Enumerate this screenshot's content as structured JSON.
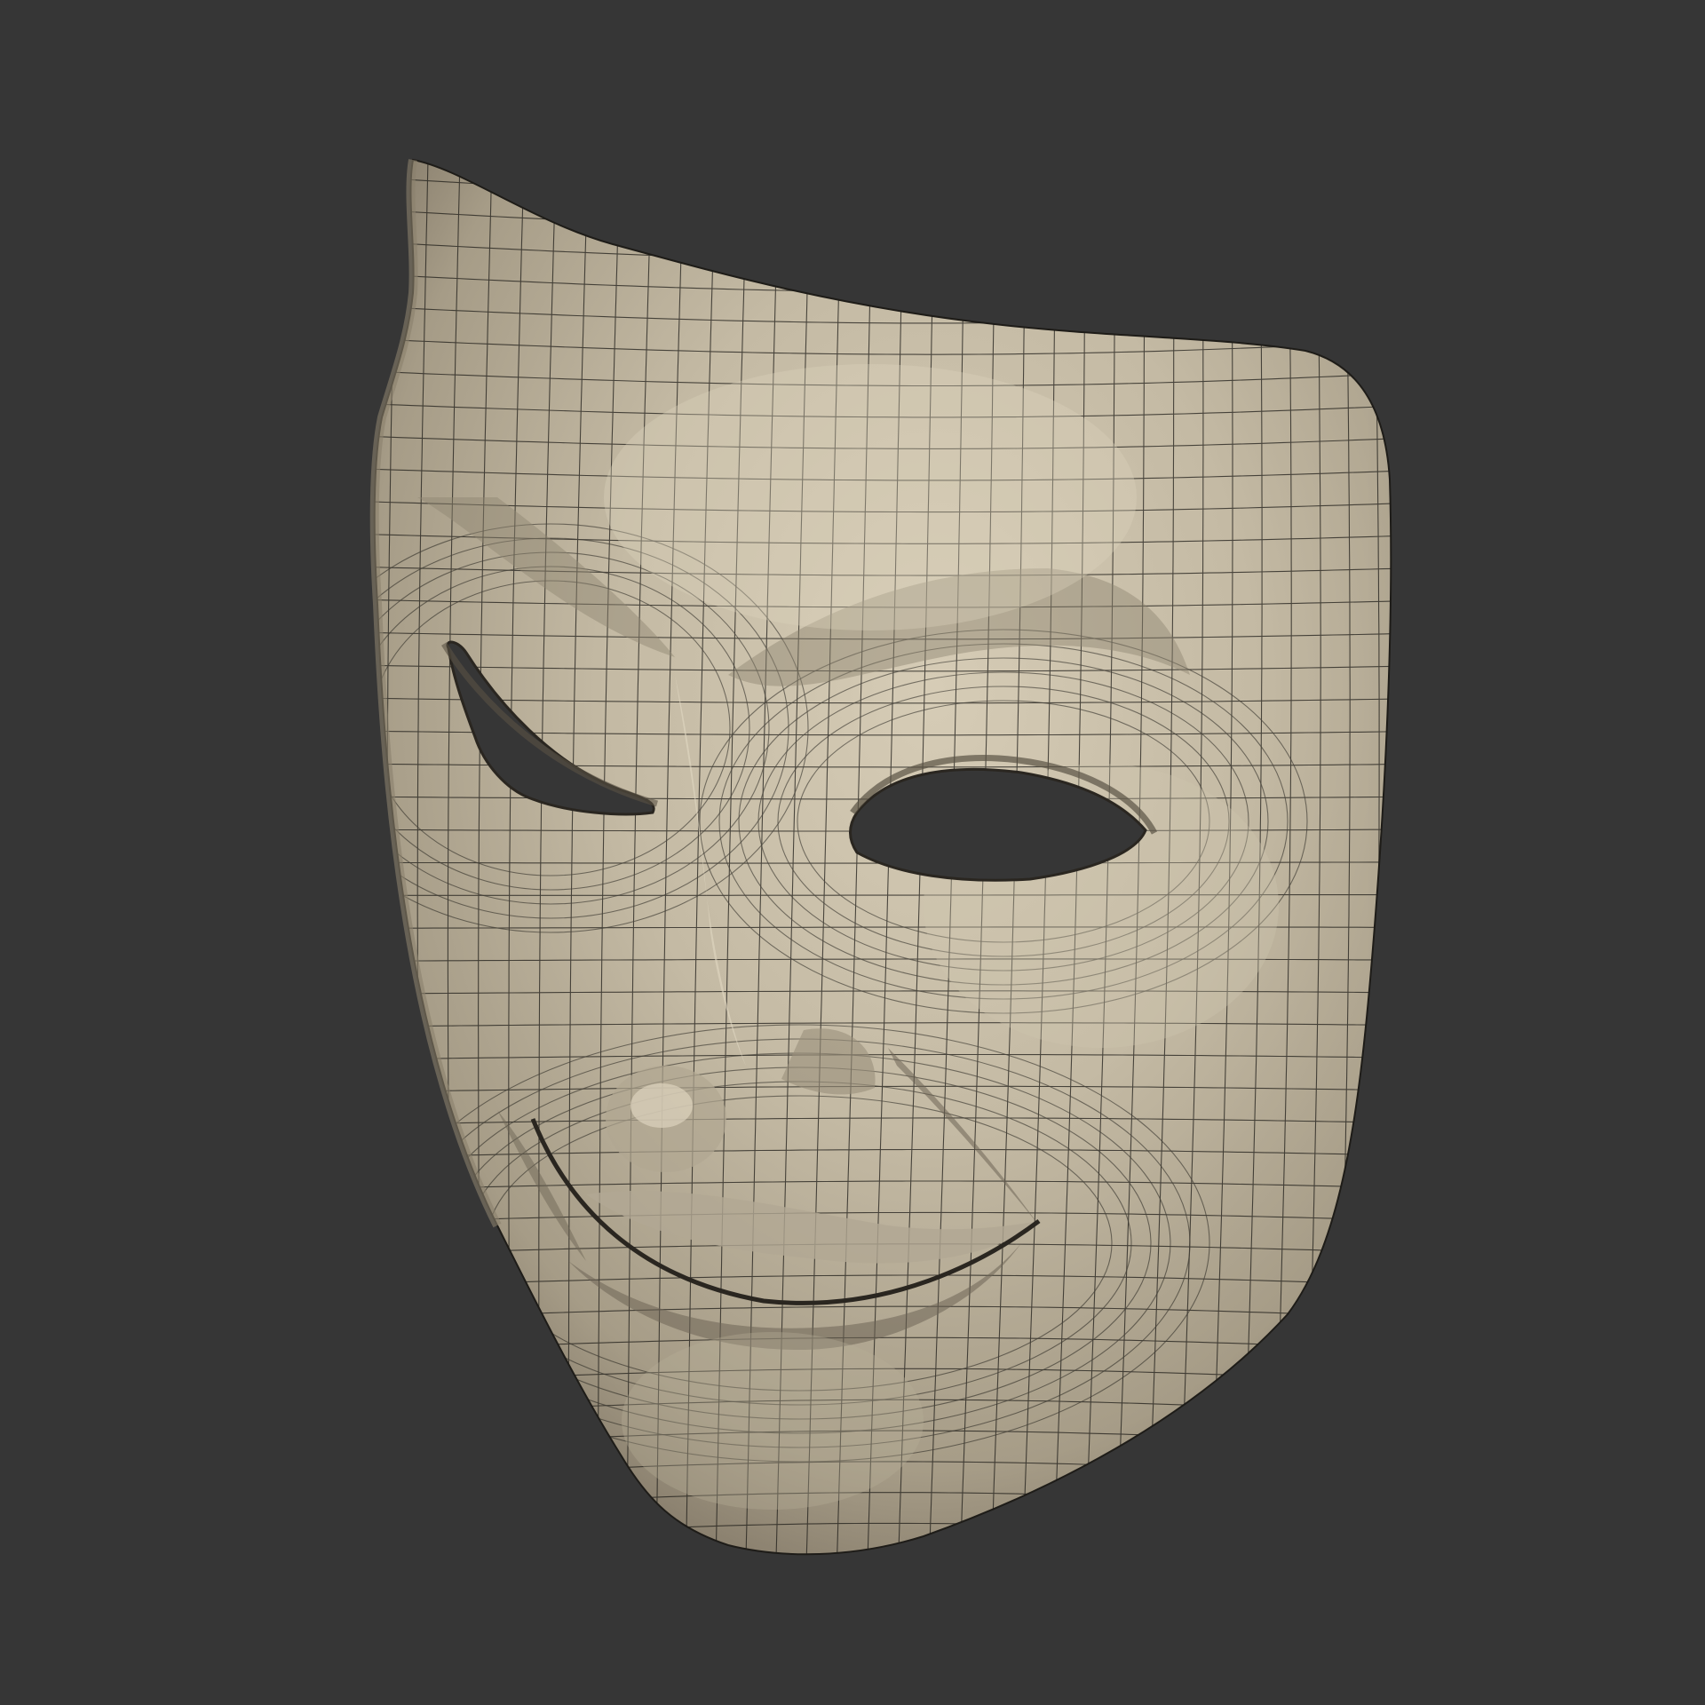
{
  "scene": {
    "subject": "mask-mesh",
    "render_mode": "shaded-wireframe",
    "background_color": "#363636",
    "surface_color": "#c2b8a2",
    "surface_highlight_color": "#d6ccb6",
    "surface_shadow_color": "#7a7060",
    "wire_color": "#1e1c18",
    "cavity_color": "#363636"
  }
}
